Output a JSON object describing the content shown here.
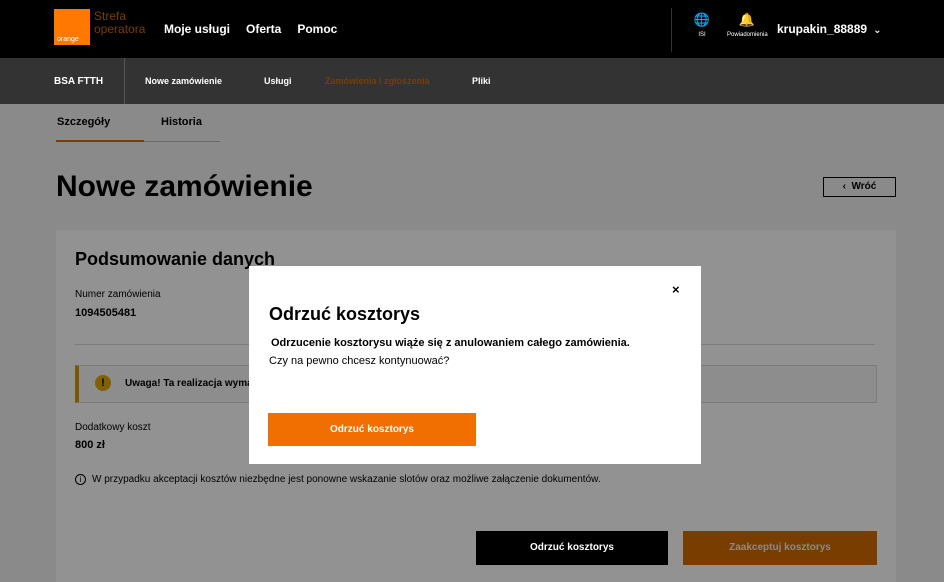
{
  "header": {
    "logo_word": "orange",
    "brand_line1": "Strefa",
    "brand_line2": "operatora",
    "nav": [
      "Moje usługi",
      "Oferta",
      "Pomoc"
    ],
    "lang_label": "ISI",
    "notifications_label": "Powiadomienia",
    "user": "krupakin_88889"
  },
  "subnav": {
    "items": [
      "BSA FTTH",
      "Nowe zamówienie",
      "Usługi",
      "Zamówienia i zgłoszenia",
      "Pliki"
    ]
  },
  "tabs": [
    "Szczegóły",
    "Historia"
  ],
  "page": {
    "title": "Nowe zamówienie",
    "back_label": "Wróć"
  },
  "card": {
    "title": "Podsumowanie danych",
    "order_label": "Numer zamówienia",
    "order_number": "1094505481",
    "warning_text": "Uwaga! Ta realizacja wyma",
    "cost_label": "Dodatkowy koszt",
    "cost_value": "800 zł",
    "info_text": "W przypadku akceptacji kosztów niezbędne jest ponowne wskazanie slotów oraz możliwe załączenie dokumentów.",
    "reject_button": "Odrzuć kosztorys",
    "accept_button": "Zaakceptuj kosztorys"
  },
  "modal": {
    "title": "Odrzuć kosztorys",
    "bold_text": "Odrzucenie kosztorysu wiąże się z anulowaniem całego zamówienia.",
    "text": "Czy na pewno chcesz kontynuować?",
    "confirm_button": "Odrzuć kosztorys",
    "close_glyph": "×"
  },
  "colors": {
    "accent": "#f16e00",
    "topbar": "#000000",
    "subnav": "#333333"
  }
}
